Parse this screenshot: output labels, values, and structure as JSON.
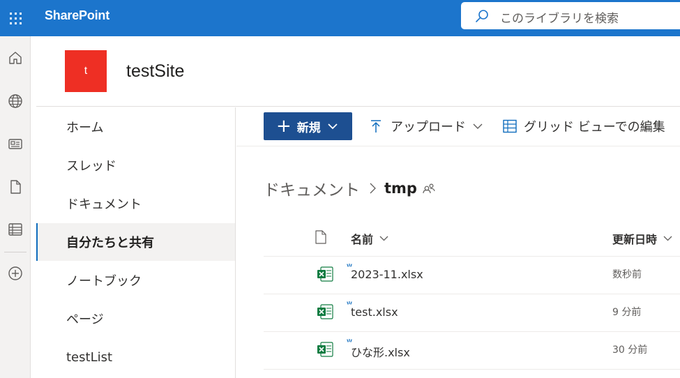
{
  "suite": {
    "brand": "SharePoint",
    "search_placeholder": "このライブラリを検索"
  },
  "app_bar": {
    "icons": [
      "home-icon",
      "globe-icon",
      "news-icon",
      "file-icon",
      "list-icon",
      "add-icon"
    ]
  },
  "site": {
    "logo_letter": "t",
    "logo_color": "#ee2f24",
    "title": "testSite"
  },
  "nav": {
    "items": [
      {
        "label": "ホーム"
      },
      {
        "label": "スレッド"
      },
      {
        "label": "ドキュメント"
      },
      {
        "label": "自分たちと共有",
        "selected": true
      },
      {
        "label": "ノートブック"
      },
      {
        "label": "ページ"
      },
      {
        "label": "testList"
      }
    ]
  },
  "command_bar": {
    "new_label": "新規",
    "upload_label": "アップロード",
    "grid_edit_label": "グリッド ビューでの編集"
  },
  "breadcrumb": {
    "root": "ドキュメント",
    "current": "tmp"
  },
  "file_list": {
    "columns": {
      "name": "名前",
      "modified": "更新日時"
    },
    "rows": [
      {
        "name": "2023-11.xlsx",
        "modified": "数秒前"
      },
      {
        "name": "test.xlsx",
        "modified": "9 分前"
      },
      {
        "name": "ひな形.xlsx",
        "modified": "30 分前"
      }
    ]
  },
  "colors": {
    "suite_bar": "#1c75cc",
    "primary_button": "#1d4f91",
    "excel_green": "#107c41",
    "new_indicator": "#0f6cbd"
  }
}
